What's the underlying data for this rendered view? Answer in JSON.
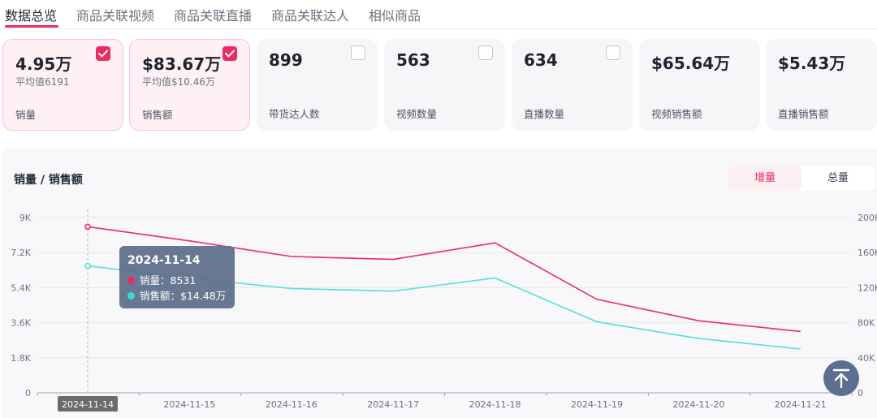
{
  "tabs": [
    {
      "label": "数据总览",
      "active": true
    },
    {
      "label": "商品关联视频",
      "active": false
    },
    {
      "label": "商品关联直播",
      "active": false
    },
    {
      "label": "商品关联达人",
      "active": false
    },
    {
      "label": "相似商品",
      "active": false
    }
  ],
  "metrics": [
    {
      "value": "4.95万",
      "sub": "平均值6191",
      "label": "销量",
      "checked": true
    },
    {
      "value": "$83.67万",
      "sub": "平均值$10.46万",
      "label": "销售额",
      "checked": true
    },
    {
      "value": "899",
      "sub": "",
      "label": "带货达人数",
      "checked": false
    },
    {
      "value": "563",
      "sub": "",
      "label": "视频数量",
      "checked": false
    },
    {
      "value": "634",
      "sub": "",
      "label": "直播数量",
      "checked": false
    },
    {
      "value": "$65.64万",
      "sub": "",
      "label": "视频销售额",
      "checked": null
    },
    {
      "value": "$5.43万",
      "sub": "",
      "label": "直播销售额",
      "checked": null
    }
  ],
  "chart_panel": {
    "title": "销量 / 销售额",
    "toggle": {
      "increment": "增量",
      "total": "总量",
      "selected": "增量"
    }
  },
  "tooltip": {
    "date": "2024-11-14",
    "rows": [
      {
        "label": "销量：8531",
        "color": "#ee2a61"
      },
      {
        "label": "销售额：$14.48万",
        "color": "#3fd9cf"
      }
    ]
  },
  "colors": {
    "accent": "#ee2a61",
    "series1": "#ee2a61",
    "series2": "#4fe0d8"
  },
  "icons": {
    "checkbox": "check-icon",
    "back_to_top": "arrow-up-icon"
  },
  "chart_data": {
    "type": "line",
    "x": [
      "2024-11-14",
      "2024-11-15",
      "2024-11-16",
      "2024-11-17",
      "2024-11-18",
      "2024-11-19",
      "2024-11-20",
      "2024-11-21"
    ],
    "series": [
      {
        "name": "销量",
        "axis": "left",
        "values": [
          8531,
          7800,
          7000,
          6850,
          7700,
          4800,
          3700,
          3150
        ]
      },
      {
        "name": "销售额",
        "axis": "right",
        "values": [
          144800,
          131000,
          119000,
          116000,
          131000,
          81000,
          62000,
          50000
        ]
      }
    ],
    "y_left": {
      "ticks": [
        "0",
        "1.8K",
        "3.6K",
        "5.4K",
        "7.2K",
        "9K"
      ],
      "range": [
        0,
        9000
      ]
    },
    "y_right": {
      "ticks": [
        "0",
        "40K",
        "80K",
        "120K",
        "160K",
        "200K"
      ],
      "range": [
        0,
        200000
      ]
    },
    "highlighted_x": "2024-11-14",
    "grid": "horizontal",
    "legend": "none"
  }
}
